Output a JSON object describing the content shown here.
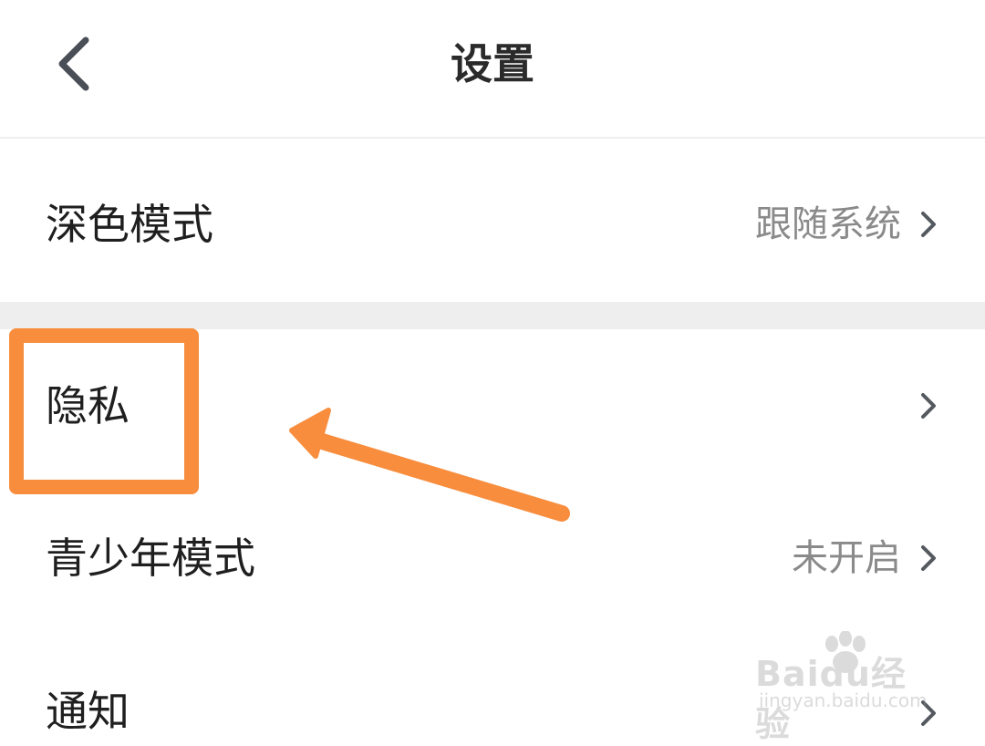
{
  "header": {
    "title": "设置",
    "back_icon": "chevron-left-icon"
  },
  "settings": [
    {
      "label": "深色模式",
      "value": "跟随系统"
    },
    {
      "label": "隐私",
      "value": ""
    },
    {
      "label": "青少年模式",
      "value": "未开启"
    },
    {
      "label": "通知",
      "value": ""
    }
  ],
  "annotation": {
    "color": "#f78d3d"
  },
  "watermark": {
    "brand": "Baidu经验",
    "url": "jingyan.baidu.com"
  }
}
